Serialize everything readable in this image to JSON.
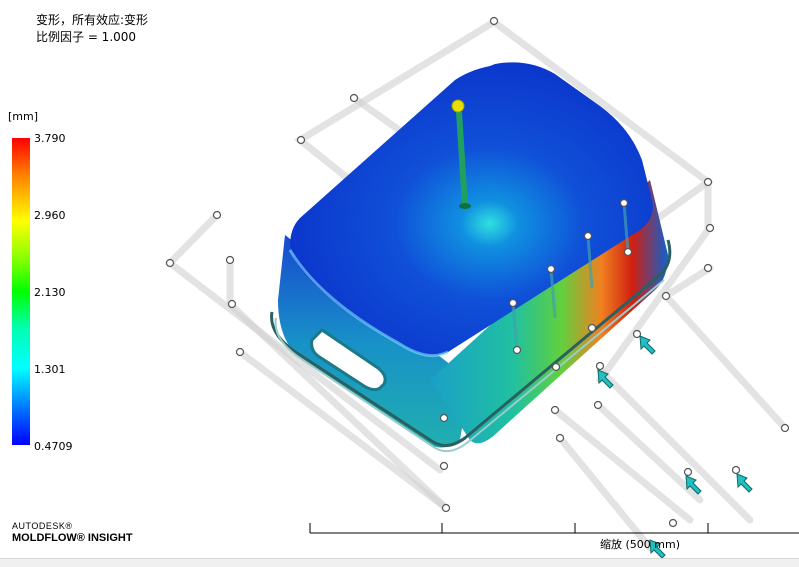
{
  "plot": {
    "title_line1": "变形，所有效应:变形",
    "title_line2": "比例因子 = 1.000"
  },
  "legend": {
    "unit": "[mm]",
    "ticks": [
      "3.790",
      "2.960",
      "2.130",
      "1.301",
      "0.4709"
    ],
    "colors": [
      "#ff0000",
      "#ffff00",
      "#00ff00",
      "#00ffff",
      "#0000ff"
    ]
  },
  "brand": {
    "line1": "AUTODESK®",
    "line2": "MOLDFLOW® INSIGHT"
  },
  "scale_bar": {
    "label": "缩放 (500 mm)"
  }
}
